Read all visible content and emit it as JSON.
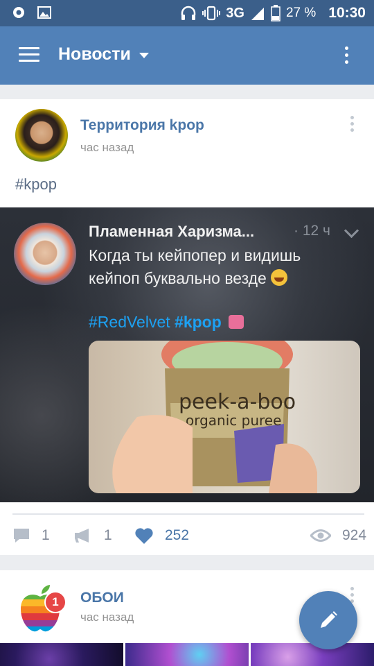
{
  "status_bar": {
    "network": "3G",
    "network_small": "3G",
    "battery": "27 %",
    "time": "10:30"
  },
  "app_bar": {
    "title": "Новости"
  },
  "posts": [
    {
      "author": "Территория kpop",
      "time": "час назад",
      "hashtag": "#kpop",
      "embed": {
        "name": "Пламенная Харизма...",
        "meta": "· 12 ч",
        "text": "Когда ты кейпопер и видишь кейпоп буквально везде",
        "tag1": "#RedVelvet",
        "tag2": "#kpop",
        "photo_text_1": "peek-a-boo",
        "photo_text_2": "organic puree"
      },
      "comments": "1",
      "reposts": "1",
      "likes": "252",
      "views": "924"
    },
    {
      "author": "ОБОИ",
      "time": "час назад",
      "badge": "1"
    }
  ],
  "colors": {
    "brand": "#5181b8",
    "status_bar": "#3b5f8a",
    "link": "#4a76a8",
    "badge": "#e64646"
  }
}
